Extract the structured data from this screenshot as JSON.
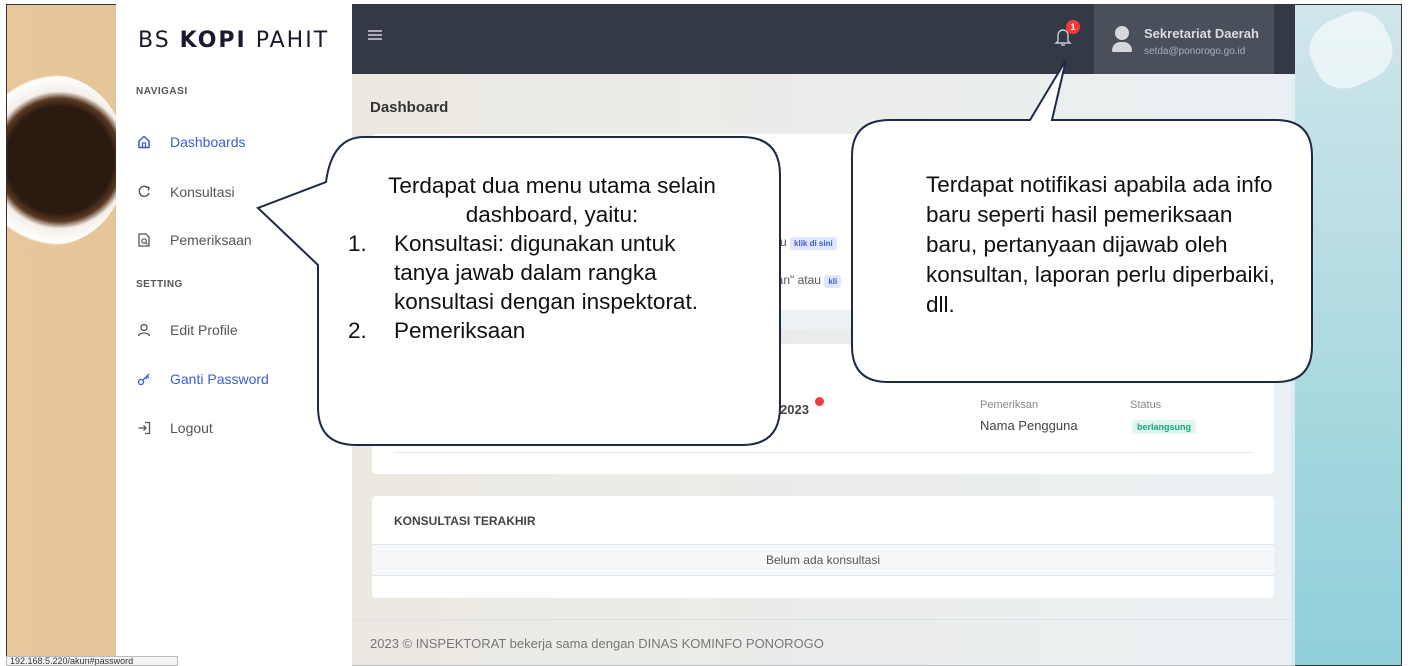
{
  "brand": {
    "logo_text_1": "BS",
    "logo_text_2": "KOPI",
    "logo_text_3": "PAHIT"
  },
  "sidebar": {
    "section_nav": "NAVIGASI",
    "section_setting": "SETTING",
    "items": [
      {
        "label": "Dashboards",
        "icon": "home-icon",
        "active": true
      },
      {
        "label": "Konsultasi",
        "icon": "refresh-icon",
        "active": false
      },
      {
        "label": "Pemeriksaan",
        "icon": "document-search-icon",
        "active": false
      },
      {
        "label": "Edit Profile",
        "icon": "user-icon",
        "active": false
      },
      {
        "label": "Ganti Password",
        "icon": "key-icon",
        "active": false
      },
      {
        "label": "Logout",
        "icon": "logout-icon",
        "active": false
      }
    ]
  },
  "topbar": {
    "notification_count": "1",
    "user_name": "Sekretariat Daerah",
    "user_email": "setda@ponorogo.go.id"
  },
  "main": {
    "page_title": "Dashboard",
    "info_line_1": "tau",
    "info_chip_1": "klik di sini",
    "info_line_2": "aan\" atau",
    "info_chip_2": "kli",
    "pemeriksaan_year": "2023",
    "col_pemeriksan_label": "Pemeriksan",
    "col_pemeriksan_value": "Nama Pengguna",
    "col_status_label": "Status",
    "col_status_value": "berlangsung",
    "konsultasi_title": "KONSULTASI TERAKHIR",
    "konsultasi_empty": "Belum ada konsultasi"
  },
  "footer": {
    "text": "2023 © INSPEKTORAT bekerja sama dengan DINAS KOMINFO PONOROGO"
  },
  "status_bar": {
    "url": "192.168.5.220/akun#password"
  },
  "callouts": {
    "left_head": "Terdapat dua menu utama selain dashboard, yaitu:",
    "left_items": [
      {
        "num": "1.",
        "text": "Konsultasi: digunakan untuk tanya jawab dalam rangka konsultasi dengan inspektorat."
      },
      {
        "num": "2.",
        "text": "Pemeriksaan"
      }
    ],
    "right_text": "Terdapat notifikasi apabila ada info baru seperti hasil pemeriksaan baru, pertanyaan dijawab oleh konsultan, laporan perlu diperbaiki, dll."
  },
  "colors": {
    "accent": "#3b5bd6",
    "topbar": "#343a45",
    "badge_red": "#ef3b3b",
    "status_green": "#1aa57a"
  }
}
